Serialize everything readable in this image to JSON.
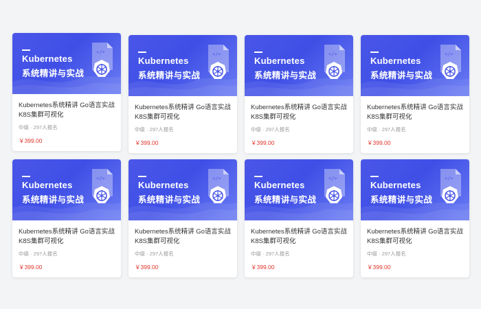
{
  "courses": [
    {
      "banner_title": "Kubernetes",
      "banner_subtitle": "系统精讲与实战",
      "title": "Kubernetes系统精讲 Go语言实战K8S集群可视化",
      "meta": "中级 · 297人报名",
      "price": "￥399.00",
      "art_icon": "kubernetes-document-icon"
    },
    {
      "banner_title": "Kubernetes",
      "banner_subtitle": "系统精讲与实战",
      "title": "Kubernetes系统精讲 Go语言实战K8S集群可视化",
      "meta": "中级 · 297人报名",
      "price": "￥399.00",
      "art_icon": "kubernetes-document-icon"
    },
    {
      "banner_title": "Kubernetes",
      "banner_subtitle": "系统精讲与实战",
      "title": "Kubernetes系统精讲 Go语言实战K8S集群可视化",
      "meta": "中级 · 297人报名",
      "price": "￥399.00",
      "art_icon": "kubernetes-document-icon"
    },
    {
      "banner_title": "Kubernetes",
      "banner_subtitle": "系统精讲与实战",
      "title": "Kubernetes系统精讲 Go语言实战K8S集群可视化",
      "meta": "中级 · 297人报名",
      "price": "￥399.00",
      "art_icon": "kubernetes-document-icon"
    },
    {
      "banner_title": "Kubernetes",
      "banner_subtitle": "系统精讲与实战",
      "title": "Kubernetes系统精讲 Go语言实战K8S集群可视化",
      "meta": "中级 · 297人报名",
      "price": "￥399.00",
      "art_icon": "kubernetes-document-icon"
    },
    {
      "banner_title": "Kubernetes",
      "banner_subtitle": "系统精讲与实战",
      "title": "Kubernetes系统精讲 Go语言实战K8S集群可视化",
      "meta": "中级 · 297人报名",
      "price": "￥399.00",
      "art_icon": "kubernetes-document-icon"
    },
    {
      "banner_title": "Kubernetes",
      "banner_subtitle": "系统精讲与实战",
      "title": "Kubernetes系统精讲 Go语言实战K8S集群可视化",
      "meta": "中级 · 297人报名",
      "price": "￥399.00",
      "art_icon": "kubernetes-document-icon"
    },
    {
      "banner_title": "Kubernetes",
      "banner_subtitle": "系统精讲与实战",
      "title": "Kubernetes系统精讲 Go语言实战K8S集群可视化",
      "meta": "中级 · 297人报名",
      "price": "￥399.00",
      "art_icon": "kubernetes-document-icon"
    }
  ],
  "colors": {
    "banner_start": "#4a56e8",
    "banner_end": "#6a7bf3",
    "price": "#e0352b",
    "page_bg": "#f3f4f6"
  }
}
